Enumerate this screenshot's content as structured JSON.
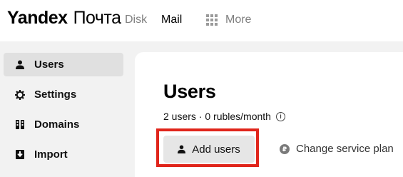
{
  "header": {
    "logo_brand": "Yandex",
    "logo_product": "Почта",
    "nav": {
      "disk": "Disk",
      "mail": "Mail",
      "more": "More"
    }
  },
  "sidebar": {
    "items": [
      {
        "label": "Users",
        "icon": "user-icon",
        "active": true
      },
      {
        "label": "Settings",
        "icon": "gear-icon",
        "active": false
      },
      {
        "label": "Domains",
        "icon": "domains-icon",
        "active": false
      },
      {
        "label": "Import",
        "icon": "import-icon",
        "active": false
      }
    ]
  },
  "main": {
    "title": "Users",
    "subtitle": "2 users · 0 rubles/month",
    "info_icon": "i",
    "add_button_label": "Add users",
    "plan_link_label": "Change service plan",
    "plan_icon": "₽"
  },
  "colors": {
    "highlight": "#e0251b",
    "background": "#f2f2f2",
    "panel": "#ffffff"
  }
}
